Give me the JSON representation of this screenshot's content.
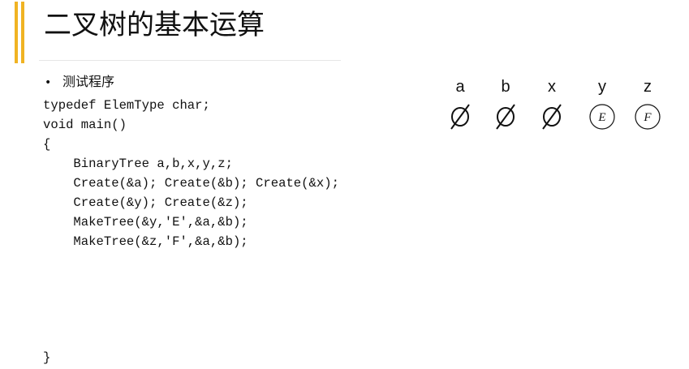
{
  "slide": {
    "title": "二叉树的基本运算",
    "bullet": "测试程序",
    "bullet_marker": "•",
    "accent_color": "#f0b323"
  },
  "code": {
    "lines": [
      "typedef ElemType char;",
      "void main()",
      "{",
      "    BinaryTree a,b,x,y,z;",
      "    Create(&a); Create(&b); Create(&x);",
      "    Create(&y); Create(&z);",
      "    MakeTree(&y,'E',&a,&b);",
      "    MakeTree(&z,'F',&a,&b);"
    ],
    "closing": "}"
  },
  "variables": [
    {
      "name": "a",
      "state": "empty",
      "icon": "empty-set-icon"
    },
    {
      "name": "b",
      "state": "empty",
      "icon": "empty-set-icon"
    },
    {
      "name": "x",
      "state": "empty",
      "icon": "empty-set-icon"
    },
    {
      "name": "y",
      "state": "node",
      "node_label": "E",
      "icon": "tree-node-icon"
    },
    {
      "name": "z",
      "state": "node",
      "node_label": "F",
      "icon": "tree-node-icon"
    }
  ]
}
